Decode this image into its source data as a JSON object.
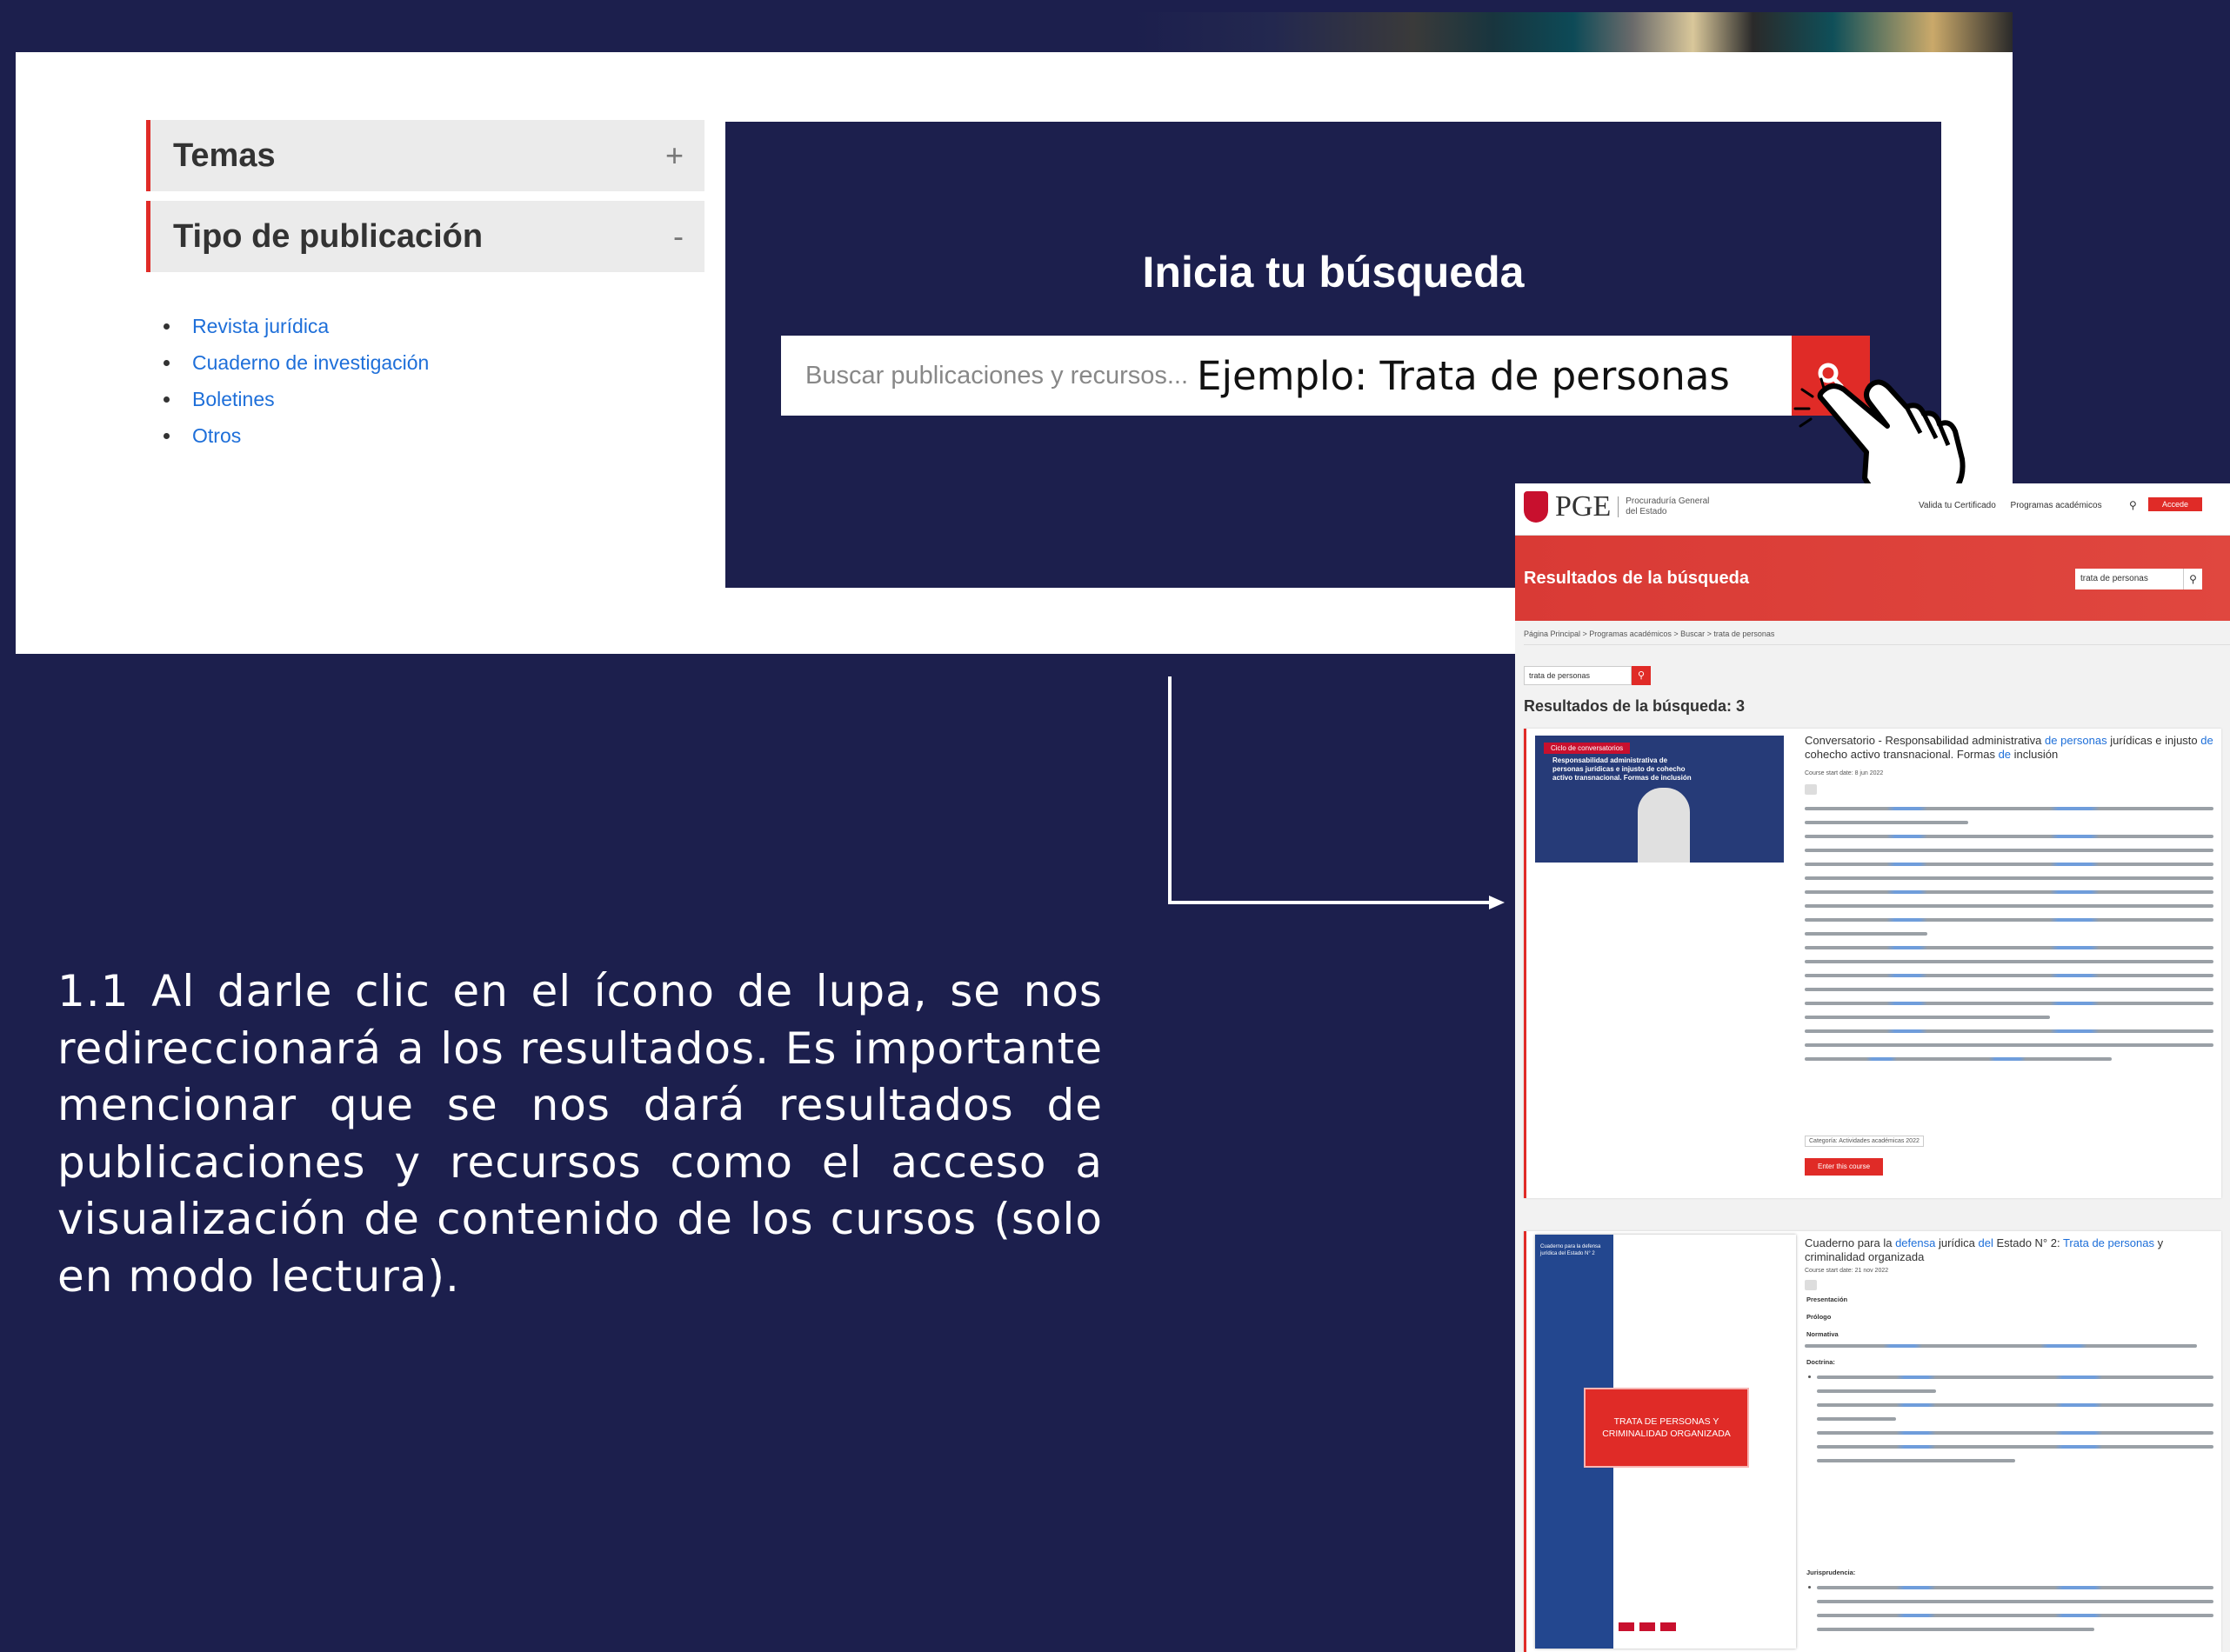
{
  "top_panel": {
    "accordion": [
      {
        "label": "Temas",
        "sign": "+"
      },
      {
        "label": "Tipo de publicación",
        "sign": "-"
      }
    ],
    "publication_types": [
      "Revista jurídica",
      "Cuaderno de investigación",
      "Boletines",
      "Otros"
    ],
    "search": {
      "title": "Inicia tu búsqueda",
      "placeholder": "Buscar publicaciones y recursos...",
      "example": "Ejemplo: Trata de personas"
    }
  },
  "instruction": "1.1 Al darle clic en el ícono de lupa, se nos redireccionará a los resultados. Es importante mencionar que se nos dará resultados de publicaciones y recursos como el acceso a visualización de contenido de los cursos (solo en modo lectura).",
  "results_page": {
    "logo": {
      "brand": "PGE",
      "subtitle": "Procuraduría General del Estado"
    },
    "nav": [
      "Valida tu Certificado",
      "Programas académicos"
    ],
    "login_label": "Accede",
    "banner_title": "Resultados de la búsqueda",
    "search_value": "trata de personas",
    "breadcrumb": "Página Principal  >  Programas académicos  >  Buscar  >  trata de personas",
    "results_count": "Resultados de la búsqueda: 3",
    "results": [
      {
        "thumbnail_tag": "Ciclo de conversatorios",
        "thumbnail_title": "Responsabilidad administrativa de personas jurídicas e injusto de cohecho activo transnacional. Formas de inclusión",
        "title_prefix": "Conversatorio - Responsabilidad administrativa ",
        "title_hl1": "de personas",
        "title_mid": " jurídicas e injusto ",
        "title_hl2": "de",
        "title_mid2": " cohecho activo transnacional. Formas ",
        "title_hl3": "de",
        "title_suffix": " inclusión",
        "date": "Course start date: 8 jun 2022",
        "category": "Categoría: Actividades académicas 2022",
        "button": "Enter this course"
      },
      {
        "book_spine": "Cuaderno para la defensa jurídica del Estado N° 2",
        "book_cover_title": "TRATA DE PERSONAS Y CRIMINALIDAD ORGANIZADA",
        "title_prefix": "Cuaderno para la ",
        "title_hl1": "defensa",
        "title_mid": " jurídica ",
        "title_hl2": "del",
        "title_mid2": " Estado N° 2: ",
        "title_hl3": "Trata de personas",
        "title_suffix": " y criminalidad organizada",
        "date": "Course start date: 21 nov 2022",
        "labels": [
          "Presentación",
          "Prólogo",
          "Normativa",
          "Doctrina:",
          "Jurisprudencia:"
        ]
      }
    ]
  },
  "colors": {
    "navy": "#1c1f4d",
    "accent_red": "#e02b27",
    "link_blue": "#1e6fd9"
  }
}
